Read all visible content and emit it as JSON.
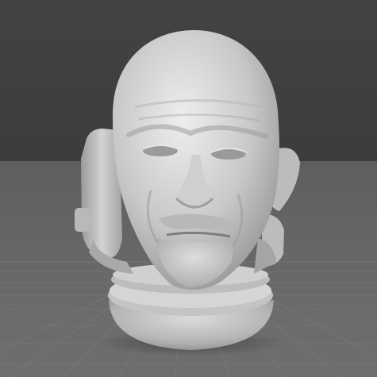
{
  "viewport": {
    "background_color": "#3f3f3f",
    "floor_color": "#6a6a6a",
    "grid_color": "#7c7c7c",
    "model_base_color": "#c9c9c9"
  },
  "model": {
    "type": "sculpted bust mesh",
    "icons": [
      "head-model",
      "neck-ring-base",
      "shoulder-armor-left",
      "shoulder-armor-right"
    ]
  }
}
